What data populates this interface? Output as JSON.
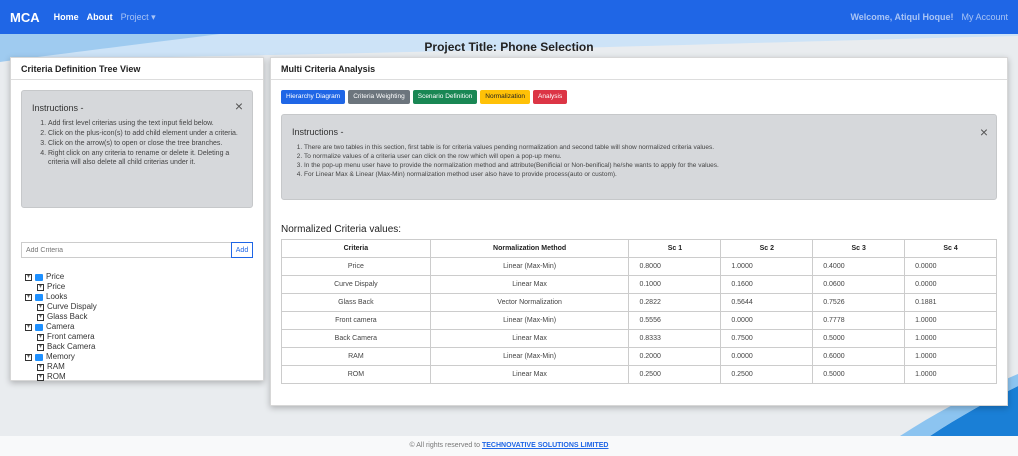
{
  "navbar": {
    "brand": "MCA",
    "links": [
      "Home",
      "About"
    ],
    "project_menu": "Project ▾",
    "welcome": "Welcome, Atiqul Hoque!",
    "account": "My Account"
  },
  "colors": {
    "navbar": "#1f66e6",
    "tab_blue": "#1f66e6",
    "tab_grey": "#6c757d",
    "tab_green": "#198754",
    "tab_yellow": "#ffc107",
    "tab_red": "#dc3545"
  },
  "project_title": "Project Title: Phone Selection",
  "left_panel": {
    "title": "Criteria Definition Tree View",
    "instructions_title": "Instructions -",
    "instructions": [
      "Add first level criterias using the text input field below.",
      "Click on the plus-icon(s) to add child element under a criteria.",
      "Click on the arrow(s) to open or close the tree branches.",
      "Right click on any criteria to rename or delete it. Deleting a criteria will also delete all child criterias under it."
    ],
    "add_placeholder": "Add Criteria",
    "add_button": "Add",
    "tree": [
      {
        "label": "Price",
        "children": [
          "Price"
        ]
      },
      {
        "label": "Looks",
        "children": [
          "Curve Dispaly",
          "Glass Back"
        ]
      },
      {
        "label": "Camera",
        "children": [
          "Front camera",
          "Back Camera"
        ]
      },
      {
        "label": "Memory",
        "children": [
          "RAM",
          "ROM"
        ]
      }
    ]
  },
  "right_panel": {
    "title": "Multi Criteria Analysis",
    "tabs": [
      "Hierarchy Diagram",
      "Criteria Weighting",
      "Scenario Definition",
      "Normalization",
      "Analysis"
    ],
    "instructions_title": "Instructions -",
    "instructions": [
      "There are two tables in this section, first table is for criteria values pending normalization and second table will show normalized criteria values.",
      "To normalize values of a criteria user can click on the row which will open a pop-up menu.",
      "In the pop-up menu user have to provide the normalization method and attribute(Benificial or Non-benifical) he/she wants to apply for the values.",
      "For Linear Max & Linear (Max-Min) normalization method user also have to provide process(auto or custom)."
    ],
    "table_title": "Normalized Criteria values:",
    "table": {
      "headers": [
        "Criteria",
        "Normalization Method",
        "Sc 1",
        "Sc 2",
        "Sc 3",
        "Sc 4"
      ],
      "rows": [
        [
          "Price",
          "Linear (Max-Min)",
          "0.8000",
          "1.0000",
          "0.4000",
          "0.0000"
        ],
        [
          "Curve Dispaly",
          "Linear Max",
          "0.1000",
          "0.1600",
          "0.0600",
          "0.0000"
        ],
        [
          "Glass Back",
          "Vector Normalization",
          "0.2822",
          "0.5644",
          "0.7526",
          "0.1881"
        ],
        [
          "Front camera",
          "Linear (Max-Min)",
          "0.5556",
          "0.0000",
          "0.7778",
          "1.0000"
        ],
        [
          "Back Camera",
          "Linear Max",
          "0.8333",
          "0.7500",
          "0.5000",
          "1.0000"
        ],
        [
          "RAM",
          "Linear (Max-Min)",
          "0.2000",
          "0.0000",
          "0.6000",
          "1.0000"
        ],
        [
          "ROM",
          "Linear Max",
          "0.2500",
          "0.2500",
          "0.5000",
          "1.0000"
        ]
      ]
    }
  },
  "footer": {
    "text": "© All rights reserved to ",
    "link": "TECHNOVATIVE SOLUTIONS LIMITED"
  }
}
